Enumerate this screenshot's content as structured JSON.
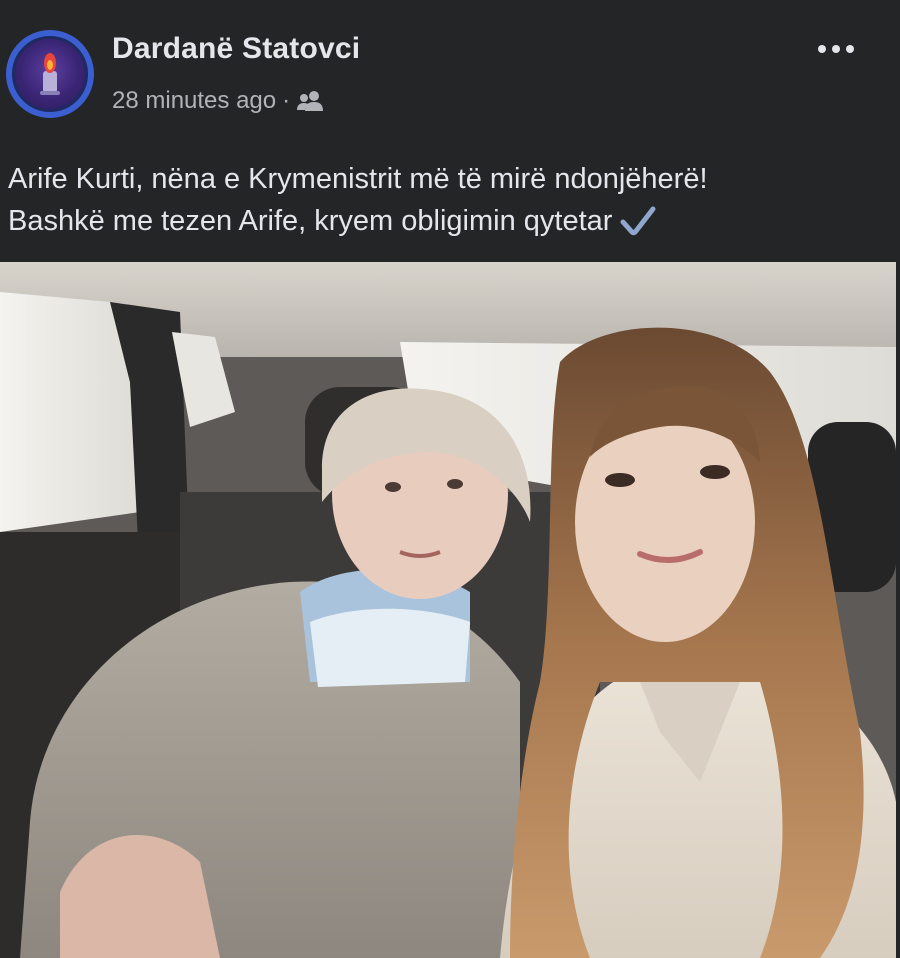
{
  "post": {
    "author": "Dardanë Statovci",
    "timestamp": "28 minutes ago",
    "separator": "·",
    "audience_icon": "friends-icon",
    "more_icon": "more-options-icon",
    "caption_line1": "Arife Kurti, nëna e Krymenistrit më të mirë ndonjëherë!",
    "caption_line2": "Bashkë me tezen Arife, kryem obligimin qytetar",
    "caption_emoji": "check-mark-icon",
    "photo_icon": "photo-selfie-in-car"
  },
  "colors": {
    "background": "#242526",
    "text_primary": "#e4e6eb",
    "text_secondary": "#b0b3b8",
    "avatar_ring": "#3b5fd0"
  }
}
